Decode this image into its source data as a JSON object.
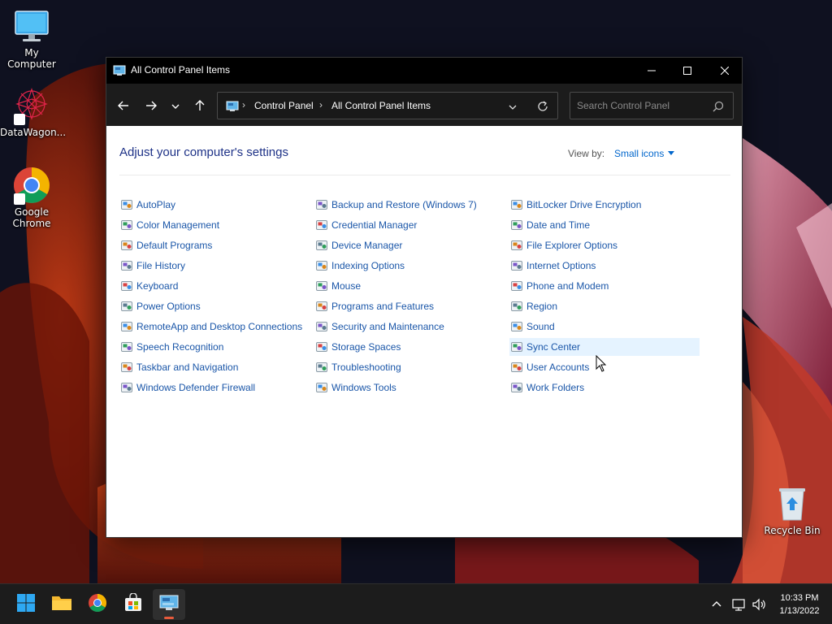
{
  "desktop": {
    "icons": [
      {
        "label": "My Computer",
        "icon": "monitor-icon"
      },
      {
        "label": "DataWagon...",
        "icon": "datawagon-icon"
      },
      {
        "label": "Google Chrome",
        "icon": "chrome-icon"
      },
      {
        "label": "Recycle Bin",
        "icon": "recycle-bin-icon"
      }
    ]
  },
  "window": {
    "title": "All Control Panel Items",
    "controls": {
      "minimize": "minimize-icon",
      "maximize": "maximize-icon",
      "close": "close-icon"
    }
  },
  "navbar": {
    "back": "arrow-left-icon",
    "forward": "arrow-right-icon",
    "recent": "chevron-down-icon",
    "up": "arrow-up-icon",
    "breadcrumb": [
      "Control Panel",
      "All Control Panel Items"
    ],
    "search_placeholder": "Search Control Panel"
  },
  "content": {
    "heading": "Adjust your computer's settings",
    "view_by_label": "View by:",
    "view_by_value": "Small icons",
    "hovered_item": "Sync Center",
    "columns": [
      [
        {
          "label": "AutoPlay",
          "icon": "autoplay-icon"
        },
        {
          "label": "Color Management",
          "icon": "color-management-icon"
        },
        {
          "label": "Default Programs",
          "icon": "default-programs-icon"
        },
        {
          "label": "File History",
          "icon": "file-history-icon"
        },
        {
          "label": "Keyboard",
          "icon": "keyboard-icon"
        },
        {
          "label": "Power Options",
          "icon": "power-options-icon"
        },
        {
          "label": "RemoteApp and Desktop Connections",
          "icon": "remoteapp-icon"
        },
        {
          "label": "Speech Recognition",
          "icon": "microphone-icon"
        },
        {
          "label": "Taskbar and Navigation",
          "icon": "taskbar-icon"
        },
        {
          "label": "Windows Defender Firewall",
          "icon": "firewall-icon"
        }
      ],
      [
        {
          "label": "Backup and Restore (Windows 7)",
          "icon": "backup-icon"
        },
        {
          "label": "Credential Manager",
          "icon": "credential-manager-icon"
        },
        {
          "label": "Device Manager",
          "icon": "device-manager-icon"
        },
        {
          "label": "Indexing Options",
          "icon": "indexing-icon"
        },
        {
          "label": "Mouse",
          "icon": "mouse-icon"
        },
        {
          "label": "Programs and Features",
          "icon": "programs-features-icon"
        },
        {
          "label": "Security and Maintenance",
          "icon": "flag-icon"
        },
        {
          "label": "Storage Spaces",
          "icon": "storage-spaces-icon"
        },
        {
          "label": "Troubleshooting",
          "icon": "troubleshooting-icon"
        },
        {
          "label": "Windows Tools",
          "icon": "windows-tools-icon"
        }
      ],
      [
        {
          "label": "BitLocker Drive Encryption",
          "icon": "bitlocker-icon"
        },
        {
          "label": "Date and Time",
          "icon": "clock-icon"
        },
        {
          "label": "File Explorer Options",
          "icon": "folder-options-icon"
        },
        {
          "label": "Internet Options",
          "icon": "internet-options-icon"
        },
        {
          "label": "Phone and Modem",
          "icon": "phone-modem-icon"
        },
        {
          "label": "Region",
          "icon": "globe-icon"
        },
        {
          "label": "Sound",
          "icon": "speaker-icon"
        },
        {
          "label": "Sync Center",
          "icon": "sync-icon"
        },
        {
          "label": "User Accounts",
          "icon": "users-icon"
        },
        {
          "label": "Work Folders",
          "icon": "work-folders-icon"
        }
      ]
    ]
  },
  "taskbar": {
    "apps": [
      {
        "name": "start",
        "icon": "windows-logo-icon"
      },
      {
        "name": "file-explorer",
        "icon": "folder-icon"
      },
      {
        "name": "chrome",
        "icon": "chrome-icon"
      },
      {
        "name": "store",
        "icon": "store-icon"
      },
      {
        "name": "control-panel",
        "icon": "control-panel-icon"
      }
    ],
    "tray": [
      "chevron-up-icon",
      "network-icon",
      "volume-icon"
    ],
    "time": "10:33 PM",
    "date": "1/13/2022"
  },
  "colors": {
    "accent": "#0066cc",
    "link": "#1a56a8",
    "heading": "#1e3287",
    "titlebar": "#000000",
    "hover": "#e5f3ff"
  }
}
